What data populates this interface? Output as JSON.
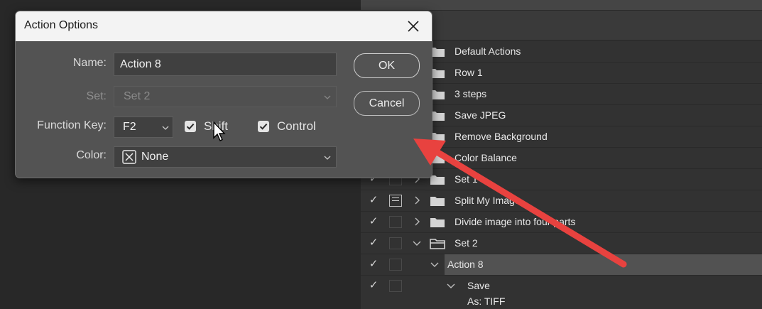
{
  "actions_panel": {
    "rows": [
      {
        "label": "Default Actions"
      },
      {
        "label": "Row 1"
      },
      {
        "label": "3 steps"
      },
      {
        "label": "Save JPEG"
      },
      {
        "label": "Remove Background"
      },
      {
        "label": "Color Balance"
      },
      {
        "label": "Set 1"
      },
      {
        "label": "Split My Image"
      },
      {
        "label": "Divide image into four parts"
      },
      {
        "label": "Set 2"
      },
      {
        "label": "Action 8"
      },
      {
        "label": "Save"
      },
      {
        "label": "As: TIFF"
      }
    ]
  },
  "dialog": {
    "title": "Action Options",
    "name_label": "Name:",
    "name_value": "Action 8",
    "set_label": "Set:",
    "set_value": "Set 2",
    "function_key_label": "Function Key:",
    "function_key_value": "F2",
    "shift_label": "Shift",
    "shift_checked": true,
    "control_label": "Control",
    "control_checked": true,
    "color_label": "Color:",
    "color_value": "None",
    "ok_label": "OK",
    "cancel_label": "Cancel"
  },
  "annotation_color": "#e8423f",
  "icons": [
    "close-icon",
    "folder-icon",
    "checkmark-icon",
    "chevron-right-icon",
    "chevron-down-icon",
    "dialog-toggle-icon",
    "x-box-icon",
    "mouse-cursor-icon",
    "red-arrow-annotation"
  ]
}
